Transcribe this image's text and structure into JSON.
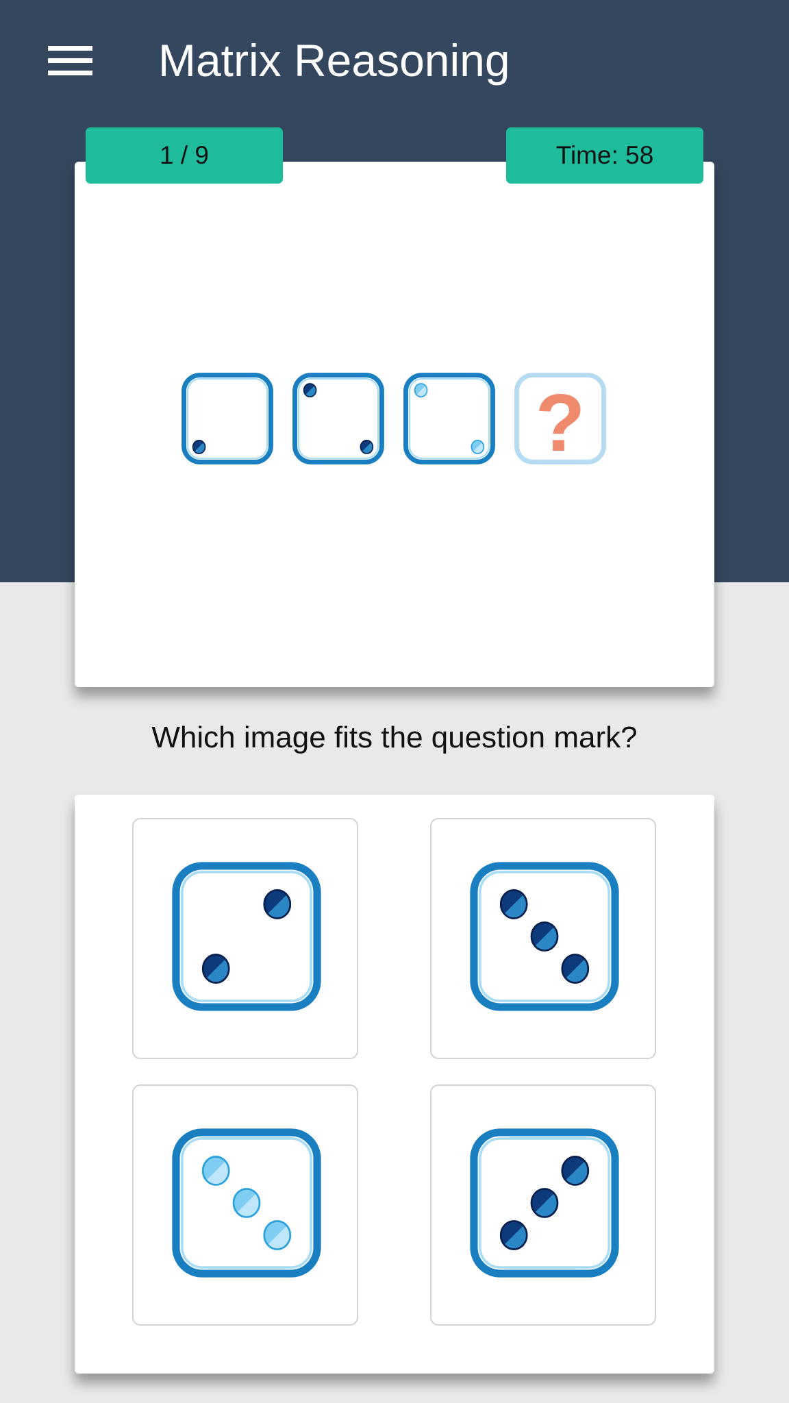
{
  "header": {
    "title": "Matrix Reasoning",
    "menu_icon": "hamburger-menu-icon"
  },
  "status": {
    "progress": "1 / 9",
    "progress_current": 1,
    "progress_total": 9,
    "timer": "Time: 58",
    "timer_seconds": 58
  },
  "colors": {
    "header_bg": "#35475e",
    "page_bg": "#e9e9e9",
    "badge_bg": "#1fbc9c",
    "die_border": "#1a7fc0",
    "dot_dark": "#0d3a7a",
    "dot_light": "#6cc3ee",
    "question_mark": "#f08a6c"
  },
  "sequence": {
    "tiles": [
      {
        "type": "die",
        "dots": [
          "bottom-left"
        ],
        "shade": "dark"
      },
      {
        "type": "die",
        "dots": [
          "top-left",
          "bottom-right"
        ],
        "shade": "dark"
      },
      {
        "type": "die",
        "dots": [
          "top-left",
          "bottom-right"
        ],
        "shade": "light"
      },
      {
        "type": "question",
        "symbol": "?"
      }
    ]
  },
  "prompt": "Which image fits the question mark?",
  "options": [
    {
      "id": "A",
      "dots": [
        "top-right",
        "bottom-left"
      ],
      "shade": "dark"
    },
    {
      "id": "B",
      "dots": [
        "top-left",
        "center",
        "bottom-right"
      ],
      "shade": "dark"
    },
    {
      "id": "C",
      "dots": [
        "top-left",
        "center",
        "bottom-right"
      ],
      "shade": "light"
    },
    {
      "id": "D",
      "dots": [
        "top-right",
        "center",
        "bottom-left"
      ],
      "shade": "dark"
    }
  ]
}
